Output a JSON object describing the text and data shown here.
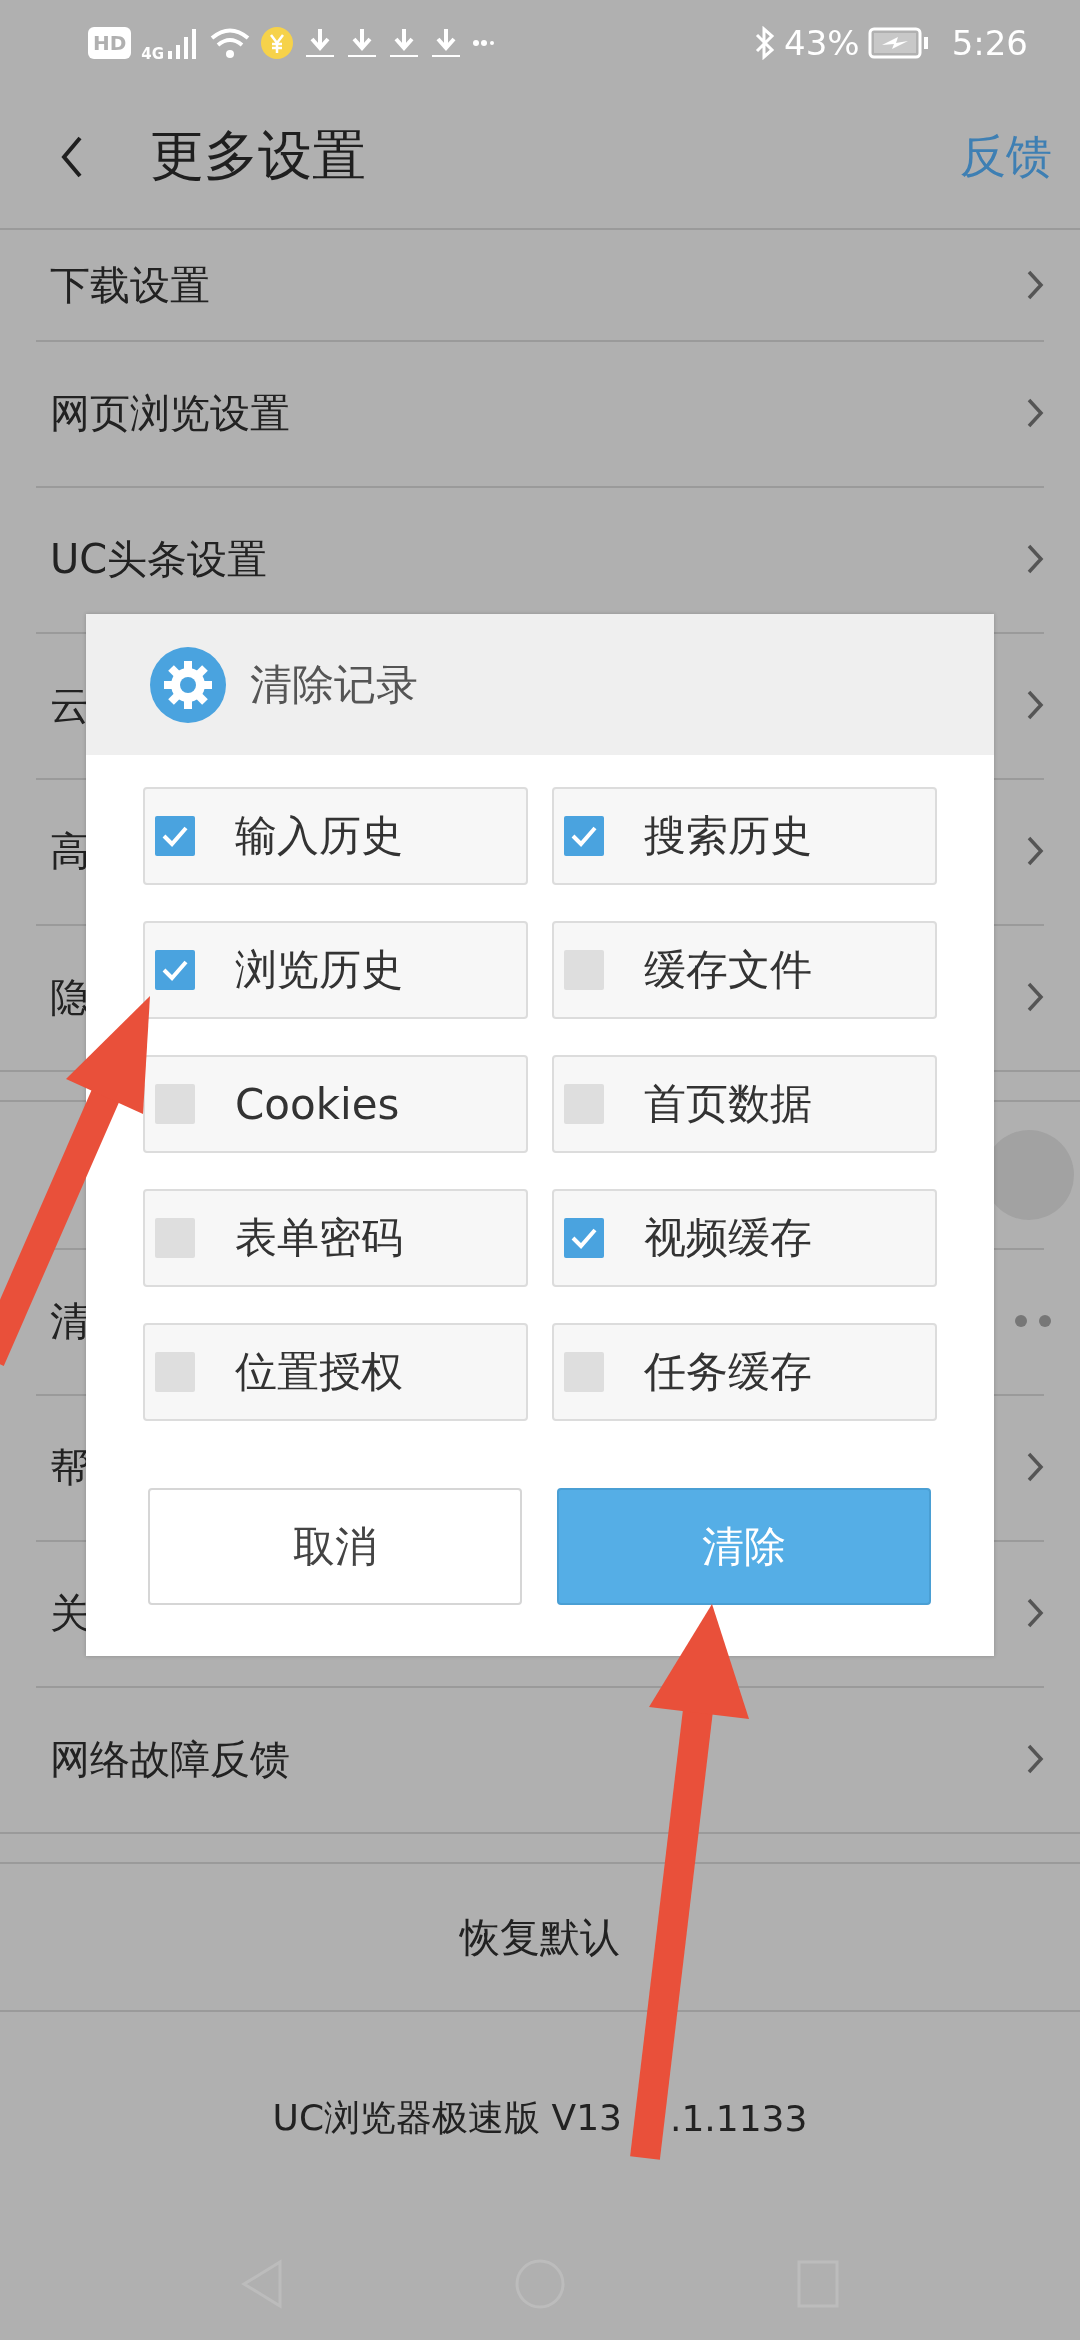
{
  "status_bar": {
    "badges": [
      "HD",
      "4G"
    ],
    "battery": "43%",
    "time": "5:26"
  },
  "header": {
    "title": "更多设置",
    "action": "反馈"
  },
  "settings_groups": [
    {
      "items": [
        {
          "label": "下载设置",
          "kind": "link"
        },
        {
          "label": "网页浏览设置",
          "kind": "link"
        },
        {
          "label": "UC头条设置",
          "kind": "link"
        },
        {
          "label": "云",
          "kind": "link"
        },
        {
          "label": "高",
          "kind": "link"
        },
        {
          "label": "隐",
          "kind": "link"
        }
      ]
    },
    {
      "items": [
        {
          "kind": "toggle"
        },
        {
          "label": "清",
          "kind": "more"
        },
        {
          "label": "帮",
          "kind": "link"
        },
        {
          "label": "关",
          "kind": "link"
        },
        {
          "label": "网络故障反馈",
          "kind": "link"
        }
      ]
    }
  ],
  "restore_button": "恢复默认",
  "version": {
    "visible_start": "UC浏览器极速版 V13",
    "visible_end": ".1.1133"
  },
  "dialog": {
    "title": "清除记录",
    "options": [
      {
        "label": "输入历史",
        "checked": true
      },
      {
        "label": "搜索历史",
        "checked": true
      },
      {
        "label": "浏览历史",
        "checked": true
      },
      {
        "label": "缓存文件",
        "checked": false
      },
      {
        "label": "Cookies",
        "checked": false
      },
      {
        "label": "首页数据",
        "checked": false
      },
      {
        "label": "表单密码",
        "checked": false
      },
      {
        "label": "视频缓存",
        "checked": true
      },
      {
        "label": "位置授权",
        "checked": false
      },
      {
        "label": "任务缓存",
        "checked": false
      }
    ],
    "buttons": [
      {
        "label": "取消",
        "kind": "secondary"
      },
      {
        "label": "清除",
        "kind": "primary"
      }
    ]
  }
}
